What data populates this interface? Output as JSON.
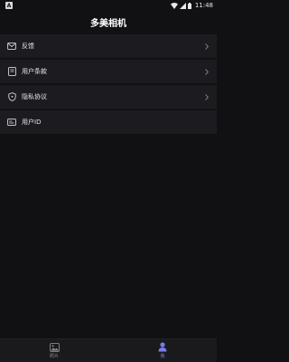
{
  "status_bar": {
    "app_badge": "A",
    "time": "11:48"
  },
  "header": {
    "title": "多美相机"
  },
  "menu": {
    "items": [
      {
        "label": "反馈",
        "icon": "mail-icon",
        "has_chevron": true
      },
      {
        "label": "用户条款",
        "icon": "document-icon",
        "has_chevron": true
      },
      {
        "label": "隐私协议",
        "icon": "shield-icon",
        "has_chevron": true
      },
      {
        "label": "用户ID",
        "icon": "id-card-icon",
        "has_chevron": false
      }
    ]
  },
  "bottom_nav": {
    "tabs": [
      {
        "label": "照片",
        "icon": "photo-icon",
        "active": false
      },
      {
        "label": "我",
        "icon": "person-icon",
        "active": true
      }
    ]
  },
  "colors": {
    "background": "#111114",
    "row_background": "#1c1c20",
    "accent": "#7a7cf0"
  }
}
